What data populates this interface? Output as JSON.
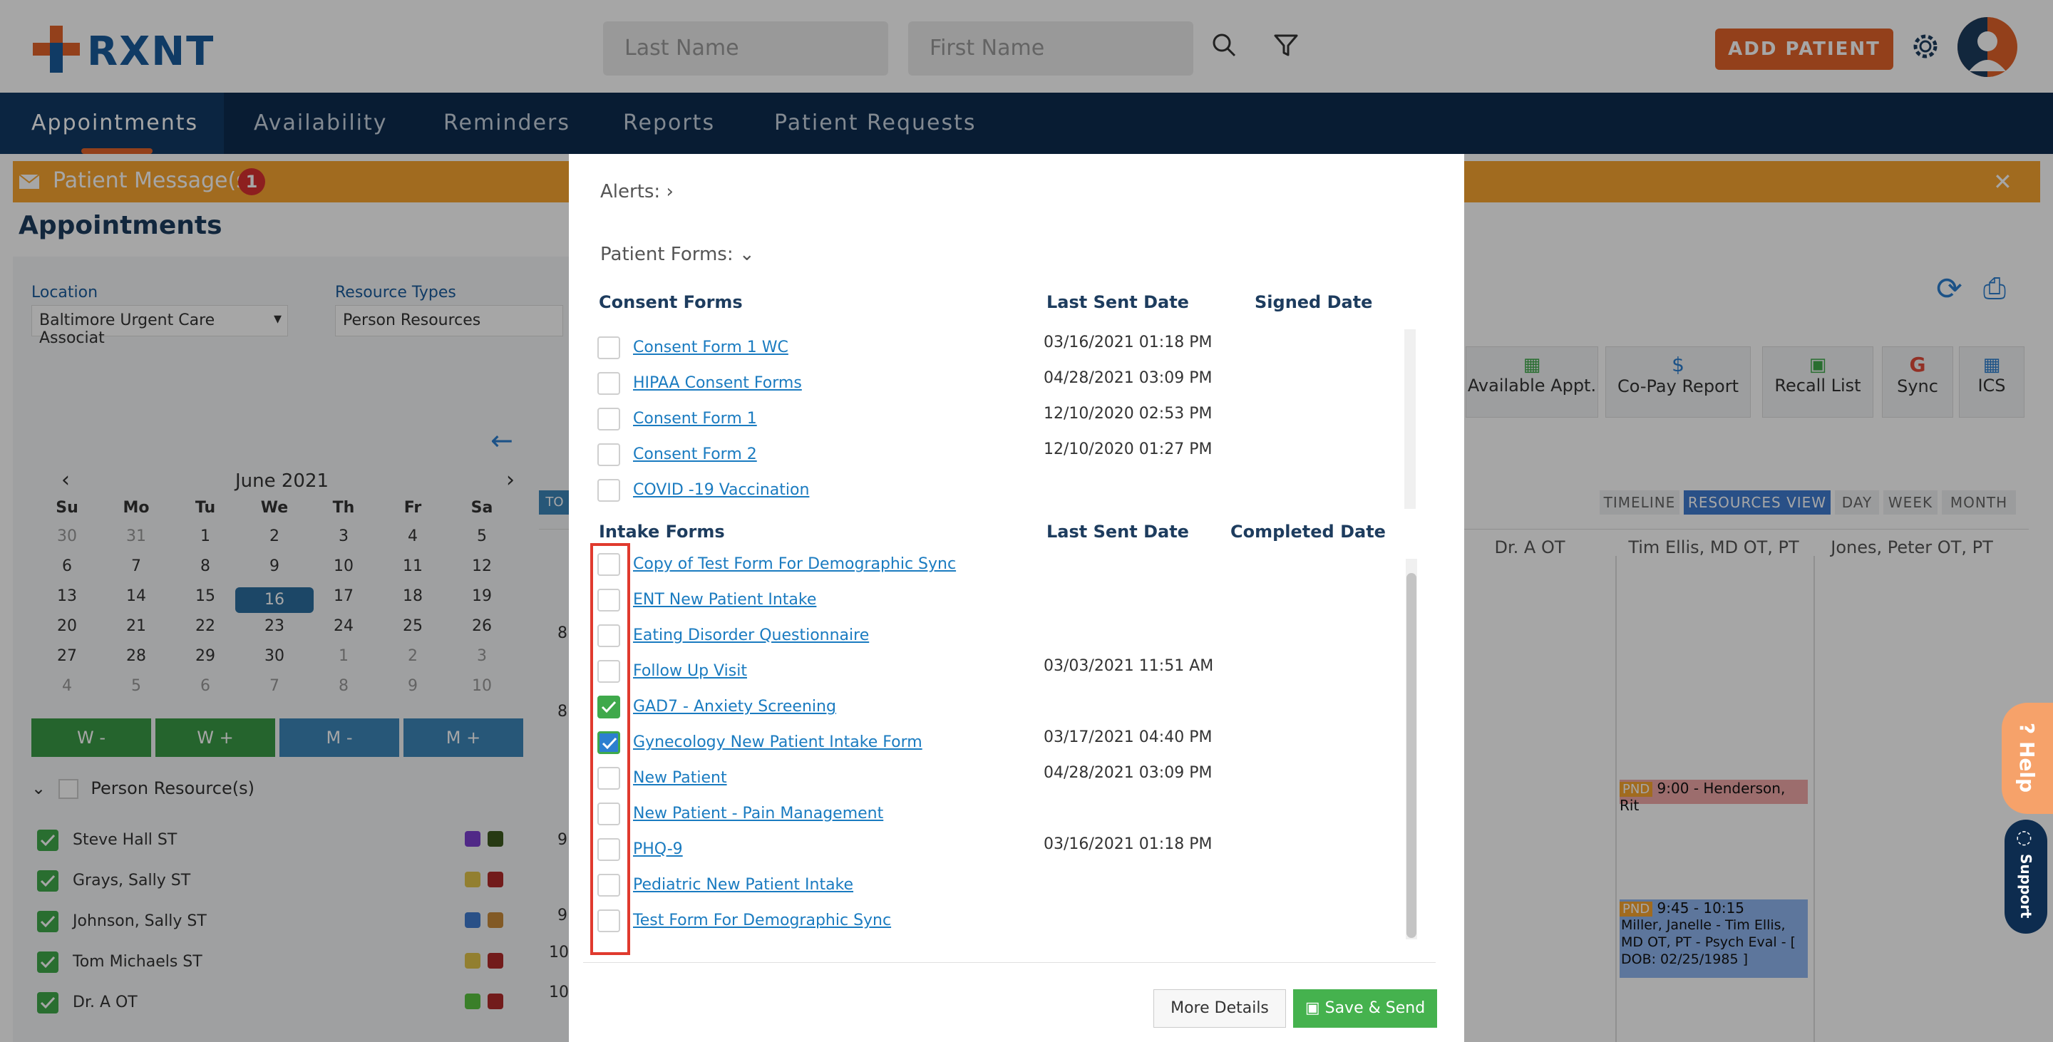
{
  "header": {
    "logo_text": "RXNT",
    "last_name_placeholder": "Last Name",
    "first_name_placeholder": "First Name",
    "add_patient_label": "ADD PATIENT"
  },
  "nav": {
    "tabs": [
      {
        "label": "Appointments",
        "active": true
      },
      {
        "label": "Availability"
      },
      {
        "label": "Reminders"
      },
      {
        "label": "Reports"
      },
      {
        "label": "Patient Requests"
      }
    ]
  },
  "banner": {
    "text": "Patient Message(s)",
    "count": "1"
  },
  "page": {
    "title": "Appointments",
    "location_label": "Location",
    "location_value": "Baltimore Urgent Care Associat",
    "resource_types_label": "Resource Types",
    "resource_types_value": "Person Resources",
    "calendar": {
      "month": "June 2021",
      "weekdays": [
        "Su",
        "Mo",
        "Tu",
        "We",
        "Th",
        "Fr",
        "Sa"
      ],
      "weeks": [
        [
          "30",
          "31",
          "1",
          "2",
          "3",
          "4",
          "5"
        ],
        [
          "6",
          "7",
          "8",
          "9",
          "10",
          "11",
          "12"
        ],
        [
          "13",
          "14",
          "15",
          "16",
          "17",
          "18",
          "19"
        ],
        [
          "20",
          "21",
          "22",
          "23",
          "24",
          "25",
          "26"
        ],
        [
          "27",
          "28",
          "29",
          "30",
          "1",
          "2",
          "3"
        ],
        [
          "4",
          "5",
          "6",
          "7",
          "8",
          "9",
          "10"
        ]
      ],
      "selected": "16"
    },
    "week_buttons": [
      "W -",
      "W +",
      "M -",
      "M +"
    ],
    "person_resources_label": "Person Resource(s)",
    "resources": [
      {
        "name": "Steve Hall ST",
        "colors": [
          "#7b3fd0",
          "#3d5a1e"
        ]
      },
      {
        "name": "Grays, Sally ST",
        "colors": [
          "#e0c44a",
          "#b02a2a"
        ]
      },
      {
        "name": "Johnson, Sally ST",
        "colors": [
          "#3f7bd0",
          "#c88a3a"
        ]
      },
      {
        "name": "Tom Michaels ST",
        "colors": [
          "#e0c44a",
          "#b02a2a"
        ]
      },
      {
        "name": "Dr. A OT",
        "colors": [
          "#5ac440",
          "#b02a2a"
        ]
      }
    ],
    "toolbar": [
      "Available Appt.",
      "Co-Pay Report",
      "Recall List",
      "Sync",
      "ICS"
    ],
    "views": [
      "TIMELINE",
      "RESOURCES VIEW",
      "DAY",
      "WEEK",
      "MONTH"
    ],
    "active_view": "RESOURCES VIEW",
    "columns": [
      "Dr. A OT",
      "Tim Ellis, MD OT, PT",
      "Jones, Peter OT, PT"
    ],
    "appointments": [
      {
        "status": "PND",
        "text": "9:00 - Henderson, Rit"
      },
      {
        "status": "PND",
        "text": "9:45 - 10:15",
        "detail": "Miller, Janelle - Tim Ellis, MD OT, PT - Psych Eval - [ DOB: 02/25/1985 ]"
      }
    ],
    "row_labels": [
      "8",
      "8",
      "9",
      "9",
      "10",
      "10"
    ]
  },
  "modal": {
    "alerts_label": "Alerts:",
    "patient_forms_label": "Patient Forms:",
    "consent": {
      "title": "Consent Forms",
      "col_sent": "Last Sent Date",
      "col_signed": "Signed Date",
      "rows": [
        {
          "name": "Consent Form 1 WC",
          "sent": "03/16/2021 01:18 PM"
        },
        {
          "name": "HIPAA Consent Forms",
          "sent": "04/28/2021 03:09 PM"
        },
        {
          "name": "Consent Form 1",
          "sent": "12/10/2020 02:53 PM"
        },
        {
          "name": "Consent Form 2",
          "sent": "12/10/2020 01:27 PM"
        },
        {
          "name": "COVID -19 Vaccination",
          "sent": ""
        }
      ]
    },
    "intake": {
      "title": "Intake Forms",
      "col_sent": "Last Sent Date",
      "col_completed": "Completed Date",
      "rows": [
        {
          "name": "Copy of Test Form For Demographic Sync",
          "sent": "",
          "checked": false
        },
        {
          "name": "ENT New Patient Intake",
          "sent": "",
          "checked": false
        },
        {
          "name": "Eating Disorder Questionnaire",
          "sent": "",
          "checked": false
        },
        {
          "name": "Follow Up Visit",
          "sent": "03/03/2021 11:51 AM",
          "checked": false
        },
        {
          "name": "GAD7 - Anxiety Screening",
          "sent": "",
          "checked": true
        },
        {
          "name": "Gynecology New Patient Intake Form",
          "sent": "03/17/2021 04:40 PM",
          "checked": true
        },
        {
          "name": "New Patient",
          "sent": "04/28/2021 03:09 PM",
          "checked": false
        },
        {
          "name": "New Patient - Pain Management",
          "sent": "",
          "checked": false
        },
        {
          "name": "PHQ-9",
          "sent": "03/16/2021 01:18 PM",
          "checked": false
        },
        {
          "name": "Pediatric New Patient Intake",
          "sent": "",
          "checked": false
        },
        {
          "name": "Test Form For Demographic Sync",
          "sent": "",
          "checked": false
        }
      ]
    },
    "more_details_label": "More Details",
    "save_send_label": "Save & Send"
  },
  "side": {
    "help_label": "? Help",
    "support_label": "Support"
  },
  "colors": {
    "brand_blue": "#1a5b9c",
    "accent_orange": "#e2632a",
    "nav_bg": "#0d2c4f",
    "check_green": "#3fa94b",
    "highlight_red": "#e03a2e"
  }
}
